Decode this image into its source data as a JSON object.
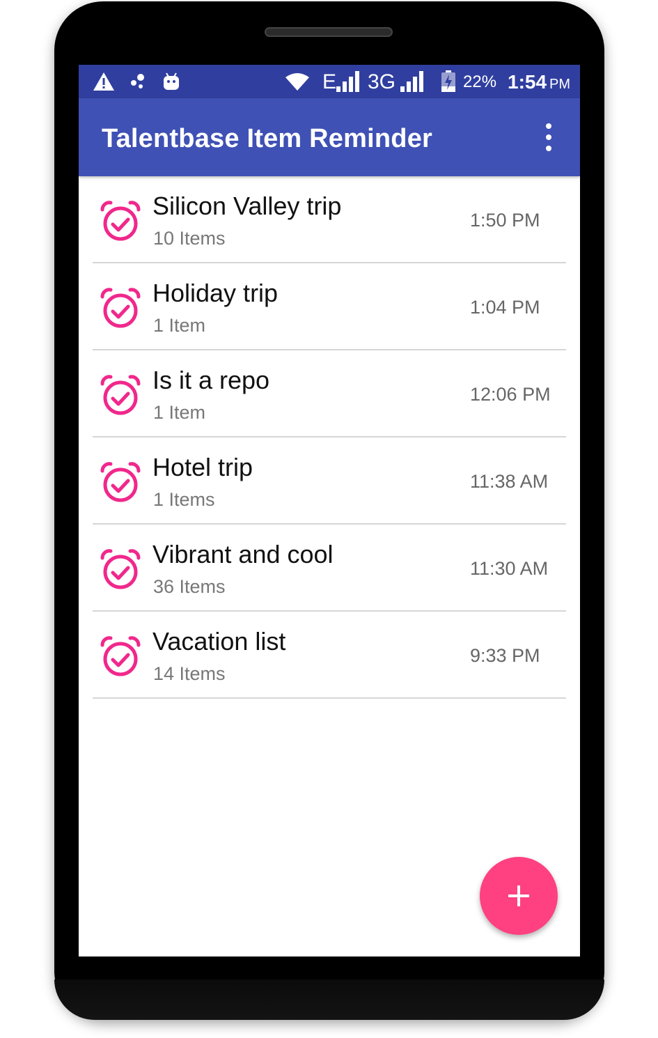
{
  "status_bar": {
    "signal_label_1": "E",
    "signal_label_2": "3G",
    "battery": "22%",
    "time": "1:54",
    "ampm": "PM",
    "icons": [
      "alert-icon",
      "bubble-icon",
      "android-icon",
      "wifi-icon",
      "cell-signal-icon",
      "battery-charging-icon"
    ]
  },
  "app_bar": {
    "title": "Talentbase Item Reminder",
    "menu_icon": "overflow-menu-icon"
  },
  "reminders": [
    {
      "title": "Silicon Valley trip",
      "count": "10 Items",
      "time": "1:50 PM"
    },
    {
      "title": "Holiday trip",
      "count": "1 Item",
      "time": "1:04 PM"
    },
    {
      "title": "Is it a repo",
      "count": "1 Item",
      "time": "12:06 PM"
    },
    {
      "title": "Hotel trip",
      "count": "1 Items",
      "time": "11:38 AM"
    },
    {
      "title": "Vibrant and cool",
      "count": "36 Items",
      "time": "11:30 AM"
    },
    {
      "title": "Vacation list",
      "count": "14 Items",
      "time": "9:33 PM"
    }
  ],
  "fab": {
    "icon": "add-icon"
  },
  "colors": {
    "primary": "#3f51b5",
    "primary_dark": "#303f9f",
    "accent": "#ff4081",
    "alarm_icon": "#f0288c"
  }
}
